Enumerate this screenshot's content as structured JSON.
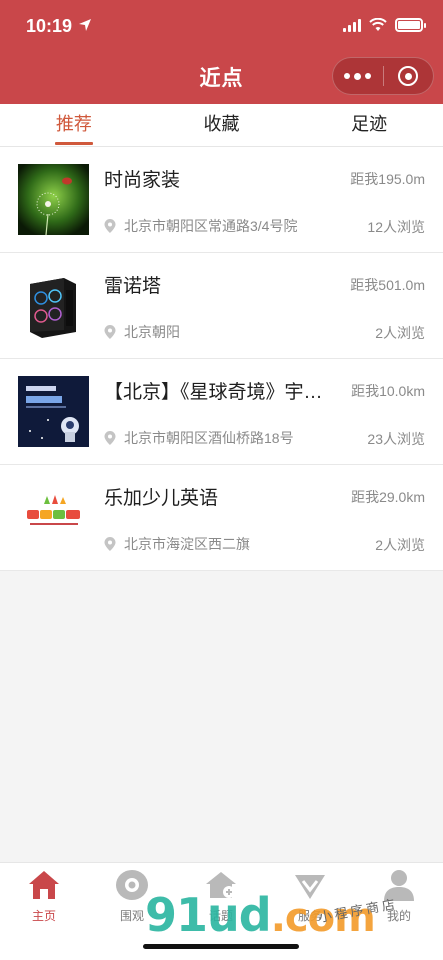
{
  "status_bar": {
    "time": "10:19"
  },
  "nav": {
    "title": "近点"
  },
  "tabs": [
    {
      "label": "推荐",
      "active": true
    },
    {
      "label": "收藏",
      "active": false
    },
    {
      "label": "足迹",
      "active": false
    }
  ],
  "items": [
    {
      "title": "时尚家装",
      "distance": "距我195.0m",
      "address": "北京市朝阳区常通路3/4号院",
      "views": "12人浏览",
      "thumb": "dandelion-photo"
    },
    {
      "title": "雷诺塔",
      "distance": "距我501.0m",
      "address": "北京朝阳",
      "views": "2人浏览",
      "thumb": "pc-case-photo"
    },
    {
      "title": "【北京】《星球奇境》宇宙探索",
      "distance": "距我10.0km",
      "address": "北京市朝阳区酒仙桥路18号",
      "views": "23人浏览",
      "thumb": "planet-poster"
    },
    {
      "title": "乐加少儿英语",
      "distance": "距我29.0km",
      "address": "北京市海淀区西二旗",
      "views": "2人浏览",
      "thumb": "kids-english-logo"
    }
  ],
  "tabbar": [
    {
      "label": "主页",
      "icon": "home-icon",
      "active": true
    },
    {
      "label": "围观",
      "icon": "eye-icon",
      "active": false
    },
    {
      "label": "话题",
      "icon": "topic-icon",
      "active": false
    },
    {
      "label": "服务",
      "icon": "service-icon",
      "active": false
    },
    {
      "label": "我的",
      "icon": "user-icon",
      "active": false
    }
  ],
  "watermark": {
    "text": "91ud",
    "suffix": ".com",
    "tagline": "小程序商店"
  },
  "colors": {
    "brand": "#c9474a",
    "active_tab": "#d0593c",
    "muted": "#8a8a8a"
  }
}
